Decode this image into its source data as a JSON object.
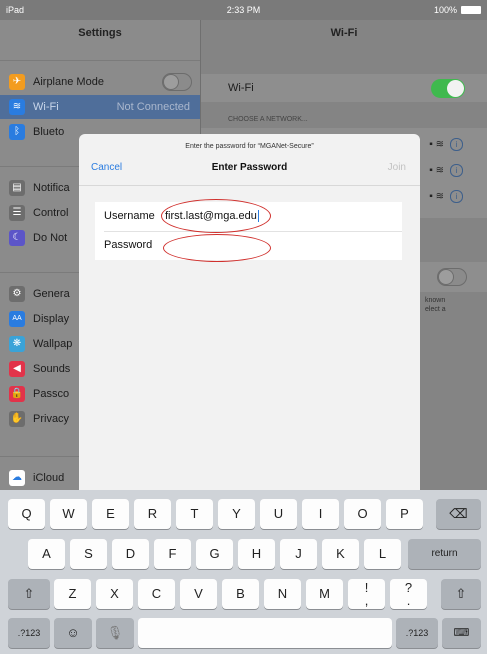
{
  "status": {
    "device": "iPad",
    "time": "2:33 PM",
    "battery": "100%"
  },
  "settings": {
    "title": "Settings",
    "group1": [
      {
        "label": "Airplane Mode",
        "icon": "airplane-icon",
        "color": "#f39c1f",
        "glyph": "✈"
      },
      {
        "label": "Wi-Fi",
        "value": "Not Connected",
        "icon": "wifi-icon",
        "color": "#2a7ce0",
        "glyph": "≋"
      },
      {
        "label": "Blueto",
        "icon": "bluetooth-icon",
        "color": "#2a7ce0",
        "glyph": "ᛒ"
      }
    ],
    "group2": [
      {
        "label": "Notifica",
        "icon": "notifications-icon",
        "color": "#6d6d6d",
        "glyph": "▤"
      },
      {
        "label": "Control",
        "icon": "control-center-icon",
        "color": "#6d6d6d",
        "glyph": "☰"
      },
      {
        "label": "Do Not",
        "icon": "moon-icon",
        "color": "#5c55c8",
        "glyph": "☾"
      }
    ],
    "group3": [
      {
        "label": "Genera",
        "icon": "gear-icon",
        "color": "#6d6d6d",
        "glyph": "⚙"
      },
      {
        "label": "Display",
        "icon": "display-icon",
        "color": "#2a7ce0",
        "glyph": "AA"
      },
      {
        "label": "Wallpap",
        "icon": "wallpaper-icon",
        "color": "#3aa3d8",
        "glyph": "❋"
      },
      {
        "label": "Sounds",
        "icon": "sounds-icon",
        "color": "#e2334a",
        "glyph": "◀"
      },
      {
        "label": "Passco",
        "icon": "lock-icon",
        "color": "#e2334a",
        "glyph": "🔒"
      },
      {
        "label": "Privacy",
        "icon": "hand-icon",
        "color": "#6d6d6d",
        "glyph": "✋"
      }
    ],
    "icloud": {
      "label": "iCloud",
      "icon": "cloud-icon",
      "color": "#2a7ce0"
    }
  },
  "wifi": {
    "title": "Wi-Fi",
    "toggle_label": "Wi-Fi",
    "toggle_on": true,
    "toggle_color": "#3fb94e",
    "choose_network": "CHOOSE A NETWORK...",
    "note_line1": "known",
    "note_line2": "elect a"
  },
  "dialog": {
    "prompt": "Enter the password for “MGANet-Secure”",
    "cancel": "Cancel",
    "title": "Enter Password",
    "join": "Join",
    "username_label": "Username",
    "username_value": "first.last@mga.edu",
    "password_label": "Password",
    "password_value": ""
  },
  "keyboard": {
    "row1": [
      "Q",
      "W",
      "E",
      "R",
      "T",
      "Y",
      "U",
      "I",
      "O",
      "P"
    ],
    "row2": [
      "A",
      "S",
      "D",
      "F",
      "G",
      "H",
      "J",
      "K",
      "L"
    ],
    "row3": [
      "Z",
      "X",
      "C",
      "V",
      "B",
      "N",
      "M",
      "!\n,",
      "?\n."
    ],
    "return": "return",
    "numbers_left": ".?123",
    "numbers_right": ".?123",
    "backspace_icon": "backspace-icon",
    "shift_icon": "shift-icon",
    "emoji_icon": "emoji-icon",
    "mic_icon": "microphone-icon",
    "hide_icon": "keyboard-hide-icon"
  }
}
